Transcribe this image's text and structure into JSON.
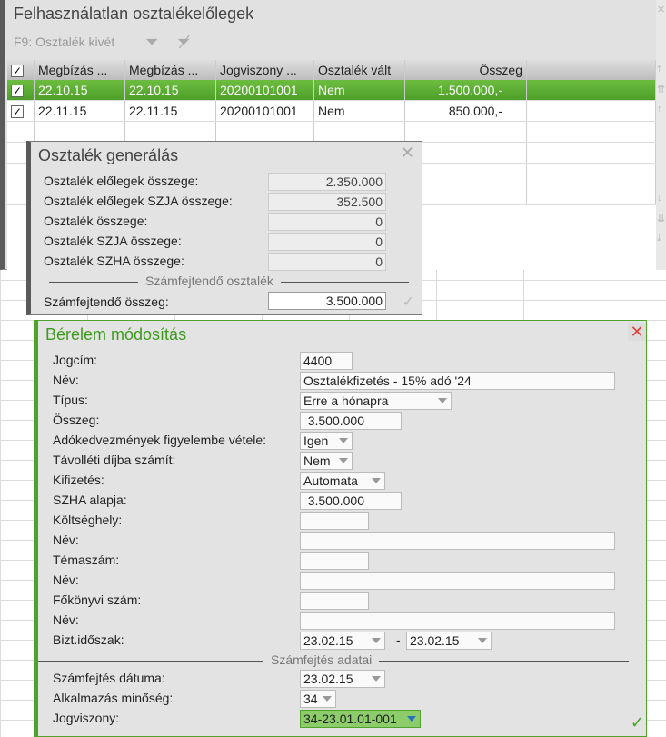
{
  "top": {
    "title": "Felhasználatlan osztalékelőlegek",
    "toolbar_label": "F9: Osztalék kivét",
    "columns": [
      "Megbízás ...",
      "Megbízás ...",
      "Jogviszony ...",
      "Osztalék vált",
      "Összeg"
    ],
    "rows": [
      [
        "22.10.15",
        "22.10.15",
        "20200101001",
        "Nem",
        "1.500.000,-"
      ],
      [
        "22.11.15",
        "22.11.15",
        "20200101001",
        "Nem",
        "850.000,-"
      ]
    ]
  },
  "gen": {
    "title": "Osztalék generálás",
    "fields": [
      {
        "label": "Osztalék előlegek összege:",
        "value": "2.350.000"
      },
      {
        "label": "Osztalék előlegek SZJA összege:",
        "value": "352.500"
      },
      {
        "label": "Osztalék összege:",
        "value": "0"
      },
      {
        "label": "Osztalék SZJA összege:",
        "value": "0"
      },
      {
        "label": "Osztalék SZHA összege:",
        "value": "0"
      }
    ],
    "section": "Számfejtendő osztalék",
    "total_label": "Számfejtendő összeg:",
    "total_value": "3.500.000"
  },
  "ber": {
    "title": "Bérelem módosítás",
    "fields": [
      {
        "label": "Jogcím:",
        "value": "4400"
      },
      {
        "label": "Név:",
        "value": "Osztalékfizetés - 15% adó          '24"
      },
      {
        "label": "Típus:",
        "value": "Erre a hónapra",
        "dropdown": true
      },
      {
        "label": "Összeg:",
        "value": "3.500.000"
      },
      {
        "label": "Adókedvezmények figyelembe vétele:",
        "value": "Igen",
        "dropdown": true
      },
      {
        "label": "Távolléti díjba számít:",
        "value": "Nem",
        "dropdown": true
      },
      {
        "label": "Kifizetés:",
        "value": "Automata",
        "dropdown": true
      },
      {
        "label": "SZHA alapja:",
        "value": "3.500.000"
      },
      {
        "label": "Költséghely:",
        "value": ""
      },
      {
        "label": "Név:",
        "value": ""
      },
      {
        "label": "Témaszám:",
        "value": ""
      },
      {
        "label": "Név:",
        "value": ""
      },
      {
        "label": "Főkönyvi szám:",
        "value": ""
      },
      {
        "label": "Név:",
        "value": ""
      },
      {
        "label": "Bizt.időszak:",
        "value": "23.02.15",
        "dropdown": true,
        "value2": "23.02.15",
        "dash": "-"
      }
    ],
    "section": "Számfejtés adatai",
    "fields2": [
      {
        "label": "Számfejtés dátuma:",
        "value": "23.02.15",
        "dropdown": true
      },
      {
        "label": "Alkalmazás minőség:",
        "value": "34",
        "dropdown": true
      },
      {
        "label": "Jogviszony:",
        "value": "34-23.01.01-001",
        "dropdown": true
      }
    ]
  },
  "colors": {
    "accent": "#4fa32a",
    "selected_row": "#5cae34",
    "close": "#d9443a"
  }
}
